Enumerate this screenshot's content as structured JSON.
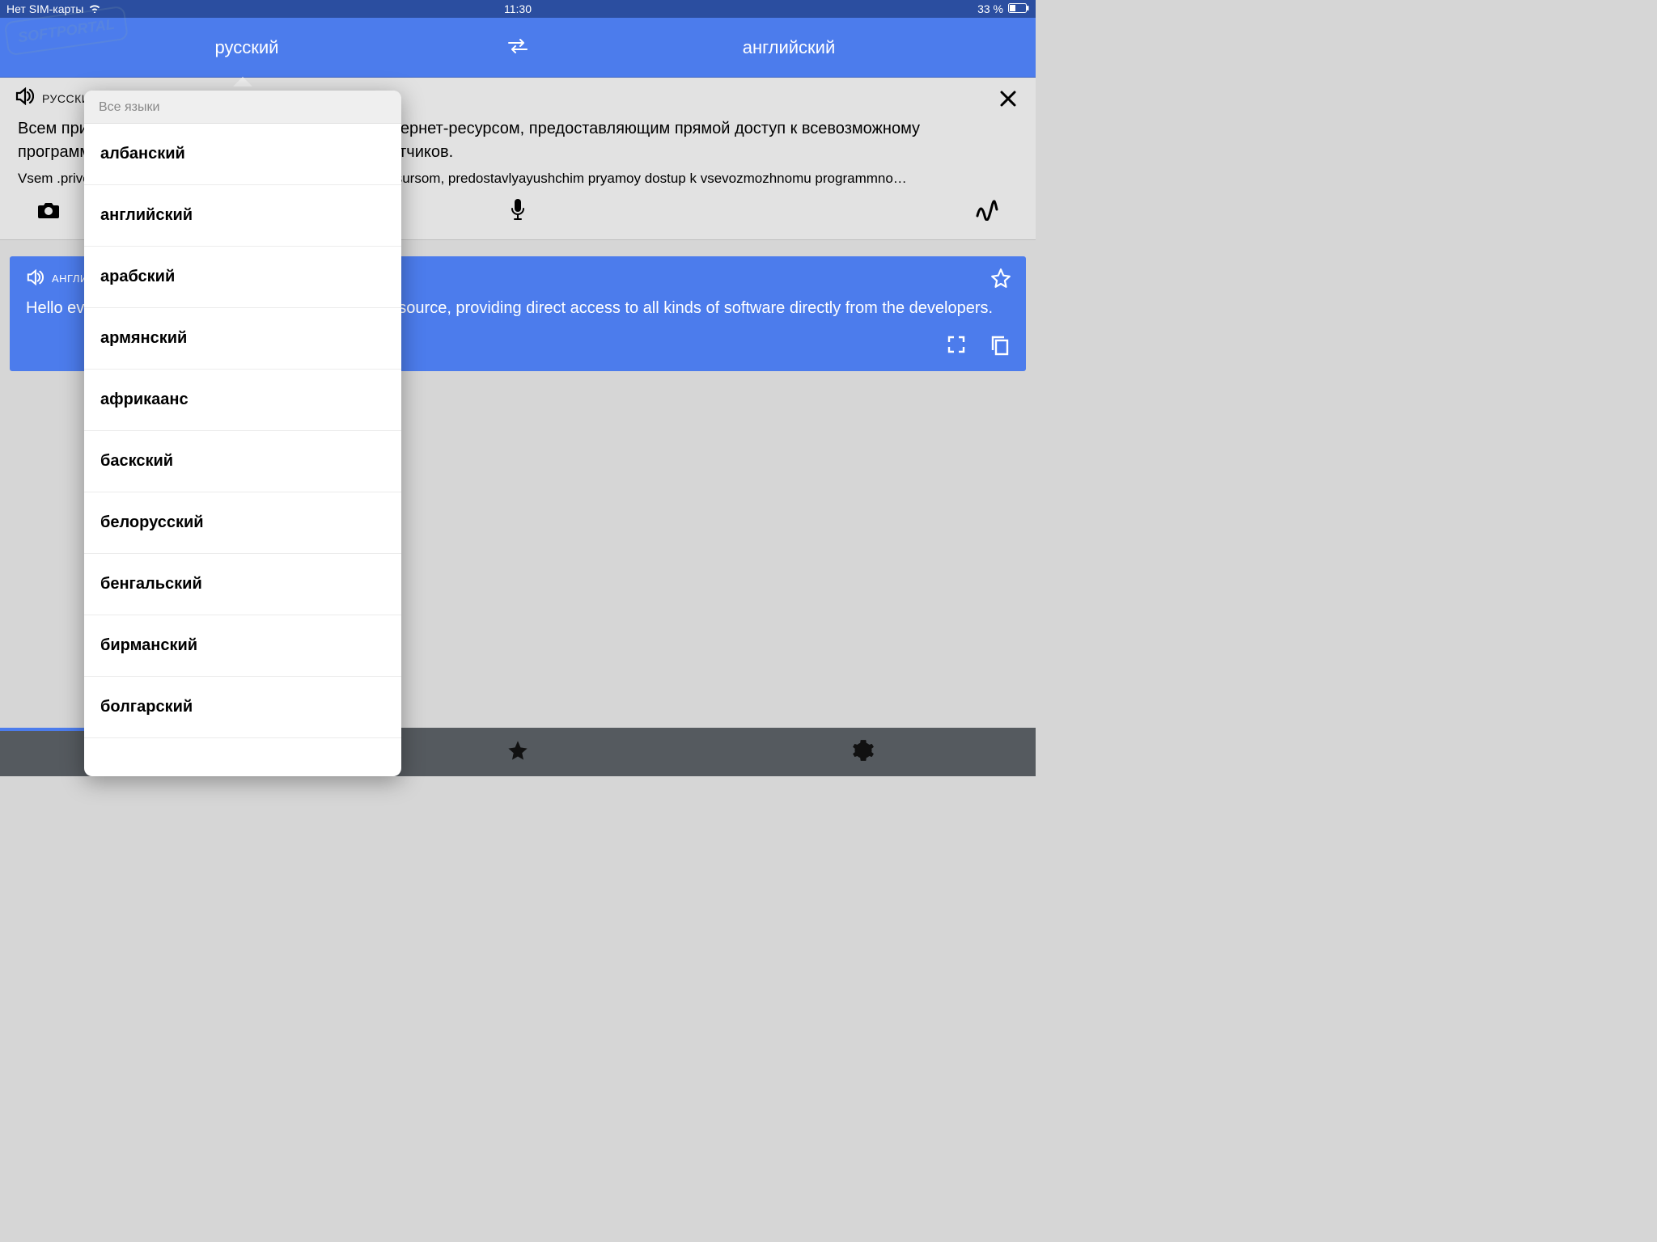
{
  "statusbar": {
    "carrier": "Нет SIM-карты",
    "time": "11:30",
    "battery_text": "33 %"
  },
  "header": {
    "source_lang": "русский",
    "target_lang": "английский"
  },
  "source": {
    "label": "РУССКИЙ",
    "text": "Всем привет. Наш сайт является независимым интернет-ресурсом, предоставляющим прямой доступ к всевозможному программному обеспечению напрямую от разработчиков.",
    "translit": "Vsem .privet. Nash sayt yavlyayetsya nezavisimym internet-resursom, predostavlyayushchim pryamoy dostup k vsevozmozhnomu programmno…"
  },
  "target": {
    "label": "АНГЛИЙСКИЙ",
    "text": "Hello everyone. Our site is an independent online resource, providing direct access to all kinds of software directly from the developers."
  },
  "lang_popover": {
    "title": "Все языки",
    "items": [
      "албанский",
      "английский",
      "арабский",
      "армянский",
      "африкаанс",
      "баскский",
      "белорусский",
      "бенгальский",
      "бирманский",
      "болгарский"
    ]
  },
  "watermark": {
    "text": "SOFTPORTAL"
  }
}
